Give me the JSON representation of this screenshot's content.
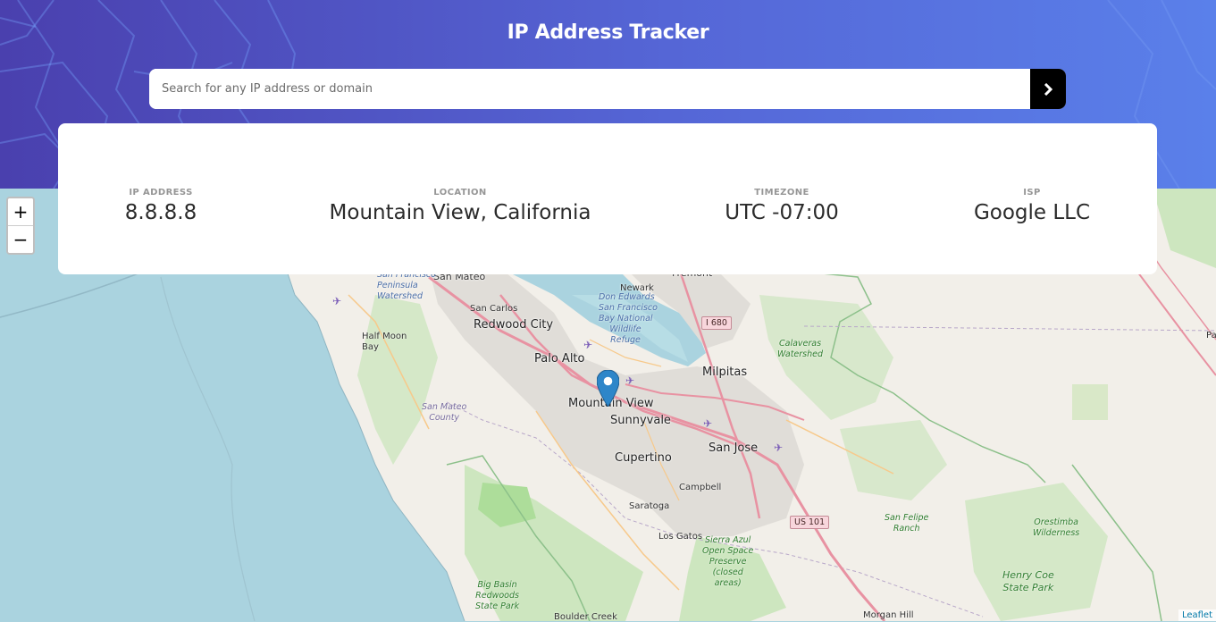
{
  "header": {
    "title": "IP Address Tracker",
    "search": {
      "placeholder": "Search for any IP address or domain",
      "value": ""
    }
  },
  "info": [
    {
      "label": "IP ADDRESS",
      "value": "8.8.8.8"
    },
    {
      "label": "LOCATION",
      "value": "Mountain View, California"
    },
    {
      "label": "TIMEZONE",
      "value": "UTC -07:00"
    },
    {
      "label": "ISP",
      "value": "Google LLC"
    }
  ],
  "map": {
    "zoom_in": "+",
    "zoom_out": "−",
    "attribution": "Leaflet",
    "marker_icon": "map-pin-icon",
    "colors": {
      "water": "#aad3df",
      "land": "#f2efe9",
      "park": "#cde6bf",
      "urban": "#e0ddd8",
      "motorway": "#e892a2",
      "header_start": "#4a40ae",
      "header_end": "#5a80ea"
    },
    "labels": {
      "san_mateo": "San Mateo",
      "fremont": "Fremont",
      "sf_peninsula": "San Francisco Peninsula Watershed",
      "san_carlos": "San Carlos",
      "redwood_city": "Redwood City",
      "newark": "Newark",
      "don_edwards": "Don Edwards San Francisco Bay National Wildlife Refuge",
      "half_moon_bay": "Half Moon Bay",
      "palo_alto": "Palo Alto",
      "milpitas": "Milpitas",
      "calaveras": "Calaveras Watershed",
      "mountain_view": "Mountain View",
      "sunnyvale": "Sunnyvale",
      "san_mateo_county": "San Mateo County",
      "san_jose": "San Jose",
      "cupertino": "Cupertino",
      "campbell": "Campbell",
      "saratoga": "Saratoga",
      "los_gatos": "Los Gatos",
      "sierra_azul": "Sierra Azul Open Space Preserve (closed areas)",
      "san_felipe": "San Felipe Ranch",
      "orestimba": "Orestimba Wilderness",
      "henry_coe": "Henry Coe State Park",
      "big_basin": "Big Basin Redwoods State Park",
      "boulder_creek": "Boulder Creek",
      "morgan_hill": "Morgan Hill",
      "edge_p": "Pa"
    },
    "shields": {
      "i680": "I 680",
      "us101": "US 101"
    }
  }
}
